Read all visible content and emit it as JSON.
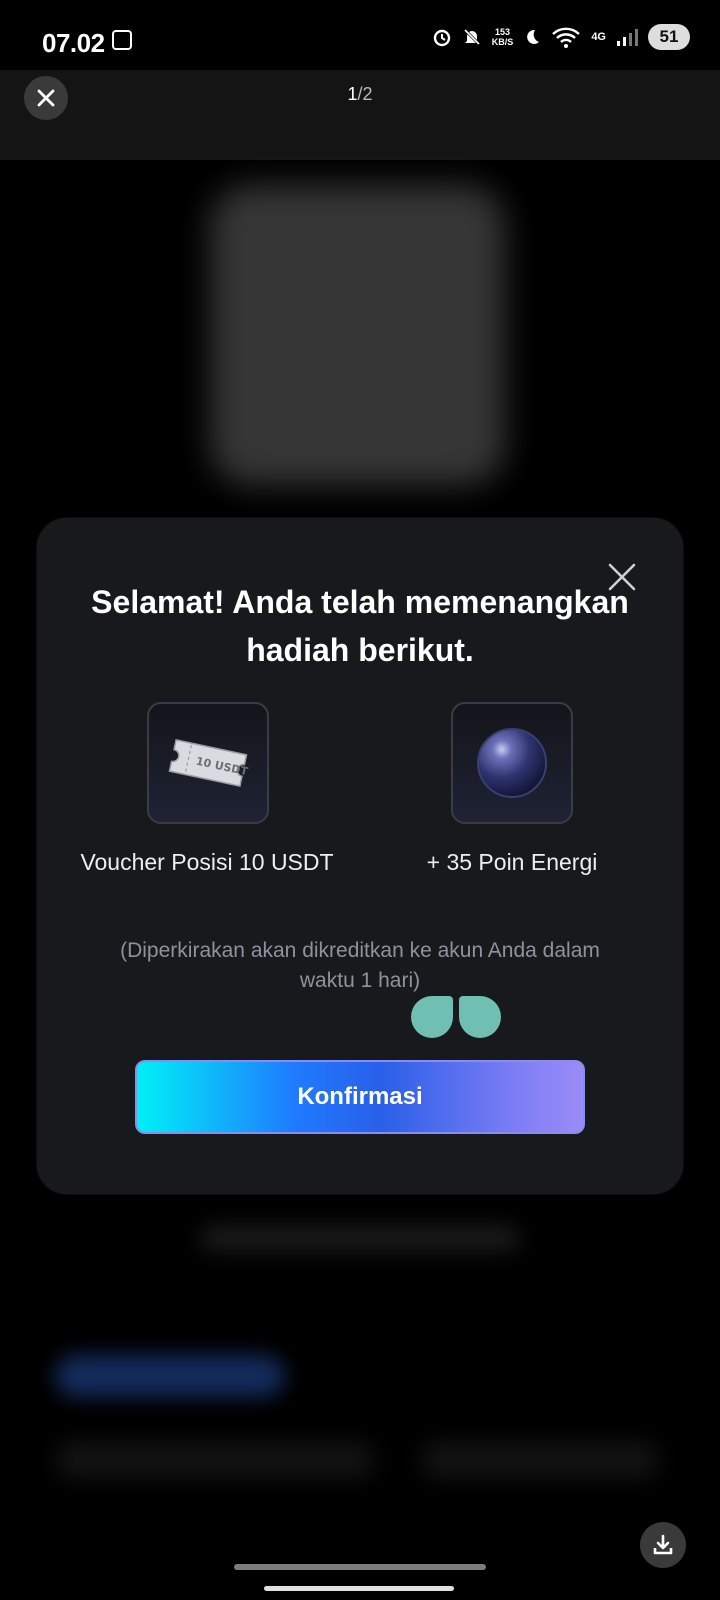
{
  "status_bar": {
    "time": "07.02",
    "net_speed": "153",
    "net_unit": "KB/S",
    "network": "4G",
    "battery": "51"
  },
  "header": {
    "page_current": "1",
    "page_total": "/2"
  },
  "modal": {
    "title": "Selamat! Anda telah memenangkan hadiah berikut.",
    "rewards": [
      {
        "name": "Voucher Posisi 10 USDT",
        "ticket_text": "10 USDT",
        "icon": "voucher-ticket-icon"
      },
      {
        "name": "+ 35 Poin Energi",
        "icon": "energy-orb-icon"
      }
    ],
    "note": "(Diperkirakan akan dikreditkan ke akun Anda dalam waktu 1 hari)",
    "confirm_label": "Konfirmasi"
  },
  "colors": {
    "modal_bg": "#18191c",
    "button_gradient_start": "#00f0f6",
    "button_gradient_mid": "#1f7bff",
    "button_gradient_end": "#9a8cf7",
    "note_text": "#8e929c",
    "deco_teal": "#6fc0b2"
  }
}
